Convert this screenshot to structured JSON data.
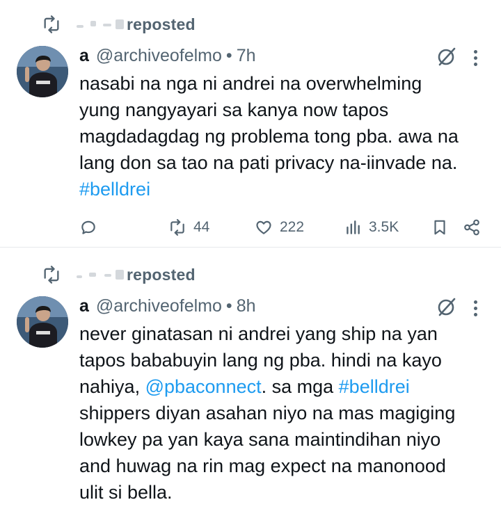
{
  "tweets": [
    {
      "repost_label": "reposted",
      "name": "a",
      "handle": "@archiveofelmo",
      "separator": "•",
      "time": "7h",
      "lines": [
        "nasabi na nga ni andrei na overwhelming",
        "yung nangyayari sa kanya now tapos",
        "magdadagdag ng problema tong pba. awa na",
        "lang don sa tao na pati privacy na-iinvade na."
      ],
      "hashtag": "#belldrei",
      "stats": {
        "reposts": "44",
        "likes": "222",
        "views": "3.5K"
      }
    },
    {
      "repost_label": "reposted",
      "name": "a",
      "handle": "@archiveofelmo",
      "separator": "•",
      "time": "8h",
      "line1": "never ginatasan ni andrei yang ship na yan",
      "line2": "tapos bababuyin lang ng pba. hindi na kayo",
      "line3_prefix": "nahiya, ",
      "mention": "@pbaconnect",
      "line3_middle": ". sa mga ",
      "hashtag": "#belldrei",
      "line4": "shippers diyan asahan niyo na mas magiging",
      "line5": "lowkey pa yan kaya sana maintindihan niyo",
      "line6": "and huwag na rin mag expect na manonood",
      "line7": "ulit si bella."
    }
  ],
  "icons": [
    "repost-icon",
    "grok-icon",
    "more-icon",
    "reply-icon",
    "like-icon",
    "views-icon",
    "bookmark-icon",
    "share-icon"
  ],
  "colors": {
    "text": "#0f1419",
    "muted": "#536471",
    "link": "#1d9bf0",
    "divider": "#e6e9ec"
  }
}
